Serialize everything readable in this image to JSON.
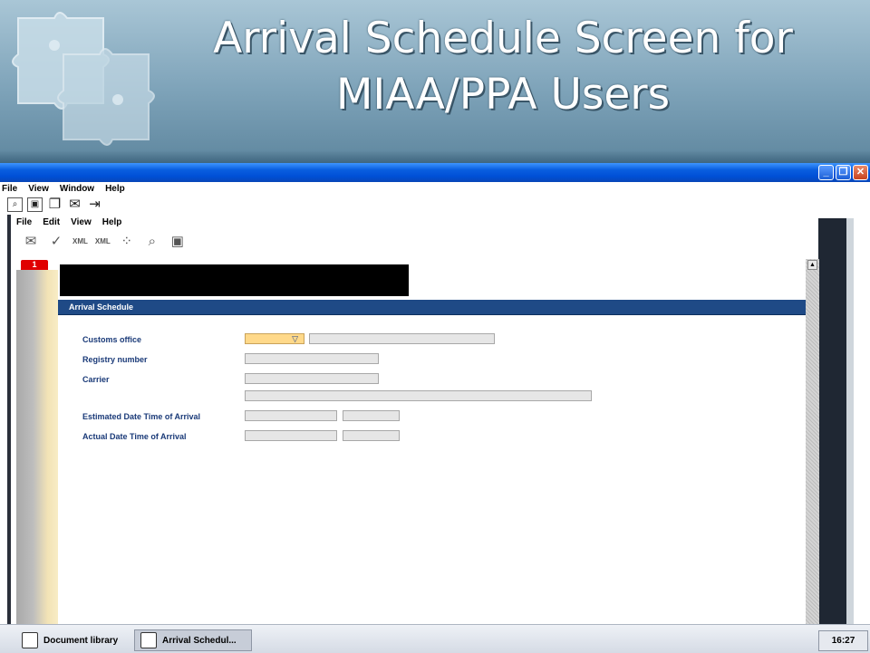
{
  "slide": {
    "title": "Arrival Schedule Screen for MIAA/PPA Users"
  },
  "window": {
    "min_label": "_",
    "max_label": "❐",
    "close_label": "✕"
  },
  "outer_menu": {
    "items": [
      "File",
      "View",
      "Window",
      "Help"
    ]
  },
  "inner_menu": {
    "items": [
      "File",
      "Edit",
      "View",
      "Help"
    ]
  },
  "toolbar2": {
    "xml1": "XML",
    "xml2": "XML"
  },
  "document": {
    "tab_number": "1",
    "section_title": "Arrival Schedule",
    "fields": {
      "customs_office_label": "Customs office",
      "registry_number_label": "Registry number",
      "carrier_label": "Carrier",
      "eta_label": "Estimated Date Time of Arrival",
      "ata_label": "Actual Date Time of Arrival"
    }
  },
  "taskbar": {
    "document_library": "Document library",
    "arrival_schedule": "Arrival Schedul...",
    "clock": "16:27"
  },
  "colors": {
    "accent": "#1f4a86",
    "select_field": "#ffd98a",
    "tab_badge": "#e00000"
  }
}
